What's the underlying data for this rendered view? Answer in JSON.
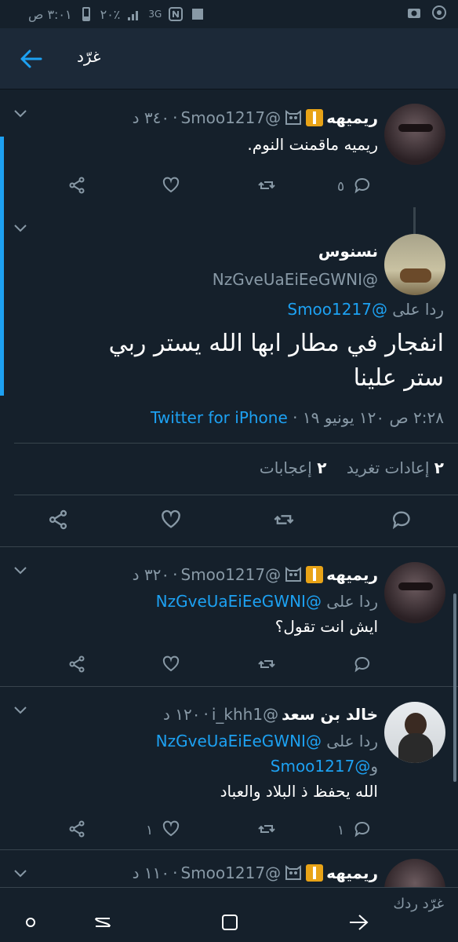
{
  "status_bar": {
    "time": "٣:٠١ ص",
    "battery": "٢٠٪",
    "network": "3G"
  },
  "app_bar": {
    "title": "غرّد"
  },
  "tweets": [
    {
      "name": "ريميهه",
      "handle": "@Smoo1217",
      "time": "٣٤٠ د",
      "text": "ريميه ماقمنت النوم.",
      "reply_count": "٥",
      "retweet_count": "",
      "like_count": ""
    },
    {
      "name": "ريميهه",
      "handle": "@Smoo1217",
      "time": "٣٢٠ د",
      "reply_prefix": "ردا على",
      "reply_to": "@NzGveUaEiEeGWNI",
      "text": "ايش انت تقول؟"
    },
    {
      "name": "خالد بن سعد",
      "handle": "@i_khh1",
      "time": "١٢٠ د",
      "reply_prefix": "ردا على",
      "reply_to": "@NzGveUaEiEeGWNI",
      "reply_to_2_prefix": "و",
      "reply_to_2": "@Smoo1217",
      "text": "الله يحفظ ذ البلاد والعباد",
      "reply_count": "١",
      "like_count": "١"
    },
    {
      "name": "ريميهه",
      "handle": "@Smoo1217",
      "time": "١١٠ د"
    }
  ],
  "focus": {
    "name": "نسنوس",
    "handle": "@NzGveUaEiEeGWNI",
    "reply_prefix": "ردا على",
    "reply_to": "@Smoo1217",
    "text_line1": "انفجار في مطار ابها الله يستر ربي",
    "text_line2": "ستر علينا",
    "timestamp": "٢:٢٨ ص ١٢٠ يونيو ١٩ ·",
    "source": "Twitter for iPhone",
    "retweets_count": "٢",
    "retweets_label": "إعادات تغريد",
    "likes_count": "٢",
    "likes_label": "إعجابات"
  },
  "reply_bar": {
    "placeholder": "غرّد ردك"
  },
  "colors": {
    "background": "#15202b",
    "accent": "#1da1f2",
    "muted": "#8899a6",
    "divider": "#38444d"
  }
}
